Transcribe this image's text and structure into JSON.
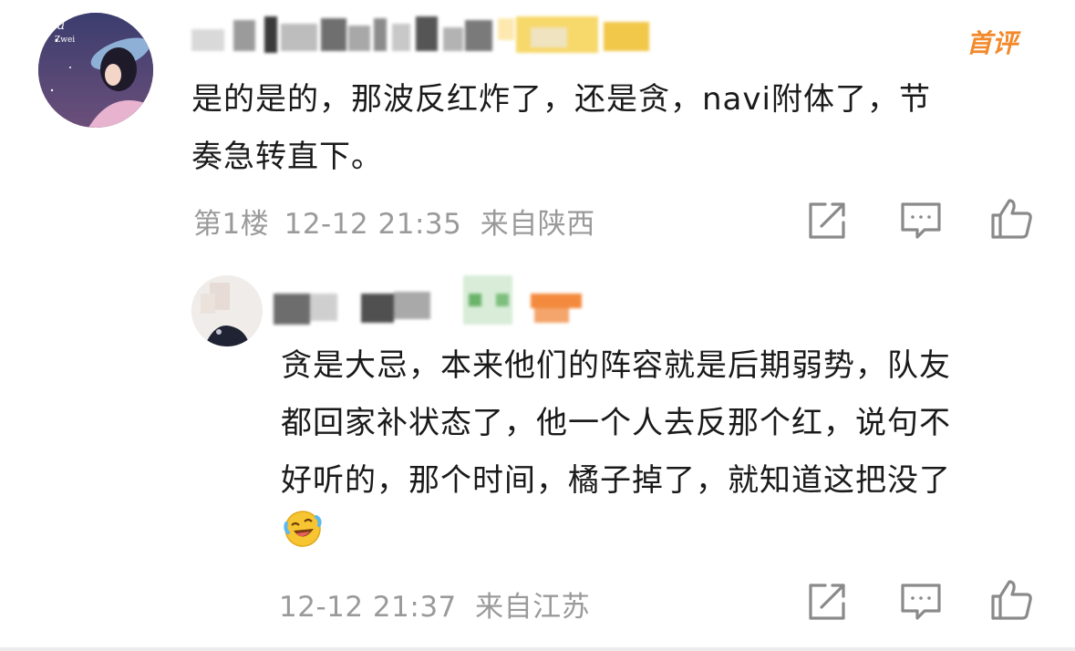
{
  "comments": [
    {
      "badge": "首评",
      "text": "是的是的，那波反红炸了，还是贪，navi附体了，节奏急转直下。",
      "text_lines": [
        "是的是的，那波反红炸了，还是贪，navi附体了，节",
        "奏急转直下。"
      ],
      "floor": "第1楼",
      "time": "12-12 21:35",
      "location": "来自陕西"
    },
    {
      "text_lines": [
        "贪是大忌，本来他们的阵容就是后期弱势，队友",
        "都回家补状态了，他一个人去反那个红，说句不",
        "好听的，那个时间，橘子掉了，就知道这把没了"
      ],
      "emoji": "laughing-crying-emoji",
      "time": "12-12 21:37",
      "location": "来自江苏"
    }
  ],
  "icons": {
    "share": "share-icon",
    "comment": "comment-icon",
    "like": "like-icon"
  },
  "colors": {
    "text": "#1a1a1a",
    "meta": "#9a9a9a",
    "badge": "#f28a2c",
    "icon": "#8a8a8a"
  }
}
